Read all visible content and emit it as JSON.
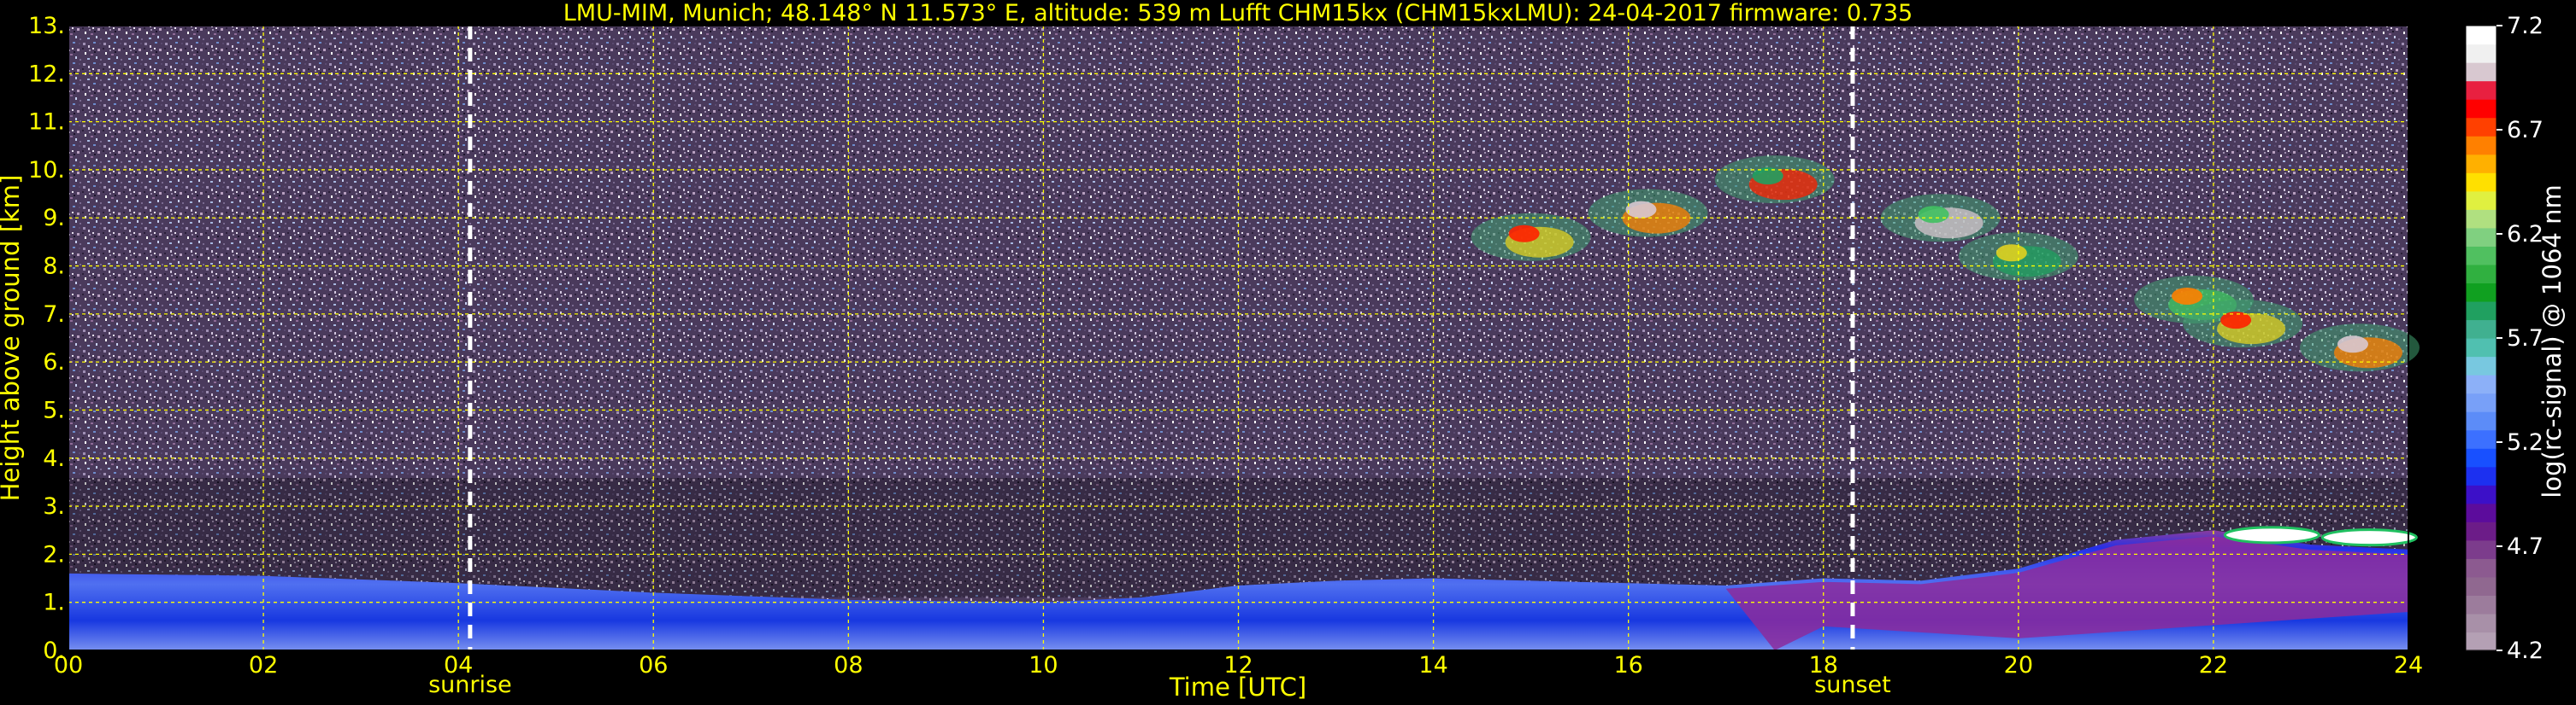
{
  "title": "LMU-MIM, Munich; 48.148° N 11.573° E, altitude: 539 m     Lufft CHM15kx (CHM15kxLMU): 24-04-2017     firmware: 0.735",
  "chart_data": {
    "type": "heatmap",
    "title": "LMU-MIM, Munich; 48.148° N 11.573° E, altitude: 539 m     Lufft CHM15kx (CHM15kxLMU): 24-04-2017     firmware: 0.735",
    "xlabel": "Time [UTC]",
    "ylabel": "Height above ground [km]",
    "xlim": [
      0,
      24
    ],
    "ylim": [
      0,
      13
    ],
    "x_ticks": [
      "00",
      "02",
      "04",
      "06",
      "08",
      "10",
      "12",
      "14",
      "16",
      "18",
      "20",
      "22",
      "24"
    ],
    "y_ticks": [
      "0.",
      "1.",
      "2.",
      "3.",
      "4.",
      "5.",
      "6.",
      "7.",
      "8.",
      "9.",
      "10.",
      "11.",
      "12.",
      "13."
    ],
    "grid": true,
    "colorbar": {
      "label": "log(rc-signal) @ 1064 nm",
      "range": [
        4.2,
        7.2
      ],
      "ticks": [
        "4.2",
        "4.7",
        "5.2",
        "5.7",
        "6.2",
        "6.7",
        "7.2"
      ],
      "colors": [
        "#b4a0b4",
        "#a890a8",
        "#9c7c9c",
        "#906890",
        "#8c5a90",
        "#7c3c8c",
        "#6c1c88",
        "#5c0c9c",
        "#3c10c8",
        "#1c30f0",
        "#1850ff",
        "#3c70ff",
        "#5c8cf8",
        "#78a0f8",
        "#8cb0f8",
        "#78c8e0",
        "#50c0b0",
        "#40b090",
        "#20a060",
        "#10a020",
        "#30b040",
        "#50c060",
        "#80d080",
        "#b0e080",
        "#e0f040",
        "#ffe000",
        "#ffb000",
        "#ff8000",
        "#ff4000",
        "#ff0000",
        "#e82040",
        "#d8c8d0",
        "#f0f0f0",
        "#ffffff"
      ]
    },
    "events": [
      {
        "name": "sunrise",
        "time": 4.12
      },
      {
        "name": "sunset",
        "time": 18.3
      }
    ],
    "layers": {
      "boundary_layer_top_km": [
        [
          0,
          1.6
        ],
        [
          2,
          1.55
        ],
        [
          4,
          1.4
        ],
        [
          6,
          1.2
        ],
        [
          8,
          1.05
        ],
        [
          10,
          1.0
        ],
        [
          11,
          1.1
        ],
        [
          12,
          1.35
        ],
        [
          13,
          1.45
        ],
        [
          14,
          1.5
        ],
        [
          15,
          1.45
        ],
        [
          16,
          1.4
        ],
        [
          17,
          1.35
        ],
        [
          18,
          1.5
        ],
        [
          19,
          1.45
        ],
        [
          20,
          1.7
        ],
        [
          21,
          2.3
        ],
        [
          22,
          2.5
        ],
        [
          23,
          2.2
        ],
        [
          24,
          2.1
        ]
      ],
      "cirrus_patches": [
        {
          "t": 15.0,
          "h_km": 8.6
        },
        {
          "t": 16.2,
          "h_km": 9.1
        },
        {
          "t": 17.5,
          "h_km": 9.8
        },
        {
          "t": 19.2,
          "h_km": 9.0
        },
        {
          "t": 20.0,
          "h_km": 8.2
        },
        {
          "t": 21.8,
          "h_km": 7.3
        },
        {
          "t": 22.3,
          "h_km": 6.8
        },
        {
          "t": 23.5,
          "h_km": 6.3
        }
      ],
      "low_cloud_km": [
        [
          22.6,
          2.4
        ],
        [
          23.6,
          2.35
        ]
      ]
    }
  }
}
